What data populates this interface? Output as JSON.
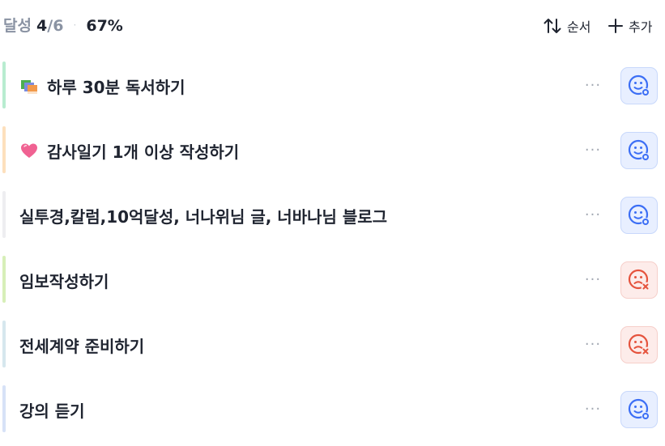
{
  "header": {
    "progress_label": "달성",
    "done_count": "4",
    "total": "/6",
    "separator": "·",
    "percent": "67%",
    "order_label": "순서",
    "add_label": "추가"
  },
  "colors": {
    "accent_blue": "#3b6ef5",
    "fail_red": "#e5533d"
  },
  "items": [
    {
      "title": "하루 30분 독서하기",
      "icon": "books-emoji",
      "bar_color": "#b8ecd0",
      "status": "done"
    },
    {
      "title": "감사일기 1개 이상 작성하기",
      "icon": "pink-heart-emoji",
      "bar_color": "#fde0bd",
      "status": "done"
    },
    {
      "title": "실투경,칼럼,10억달성, 너나위님 글, 너바나님 블로그",
      "icon": "",
      "bar_color": "#eeeef1",
      "status": "done"
    },
    {
      "title": "임보작성하기",
      "icon": "",
      "bar_color": "#d7efb8",
      "status": "fail"
    },
    {
      "title": "전세계약 준비하기",
      "icon": "",
      "bar_color": "#d6e7ee",
      "status": "fail"
    },
    {
      "title": "강의 듣기",
      "icon": "",
      "bar_color": "#d7e2f7",
      "status": "done"
    }
  ]
}
